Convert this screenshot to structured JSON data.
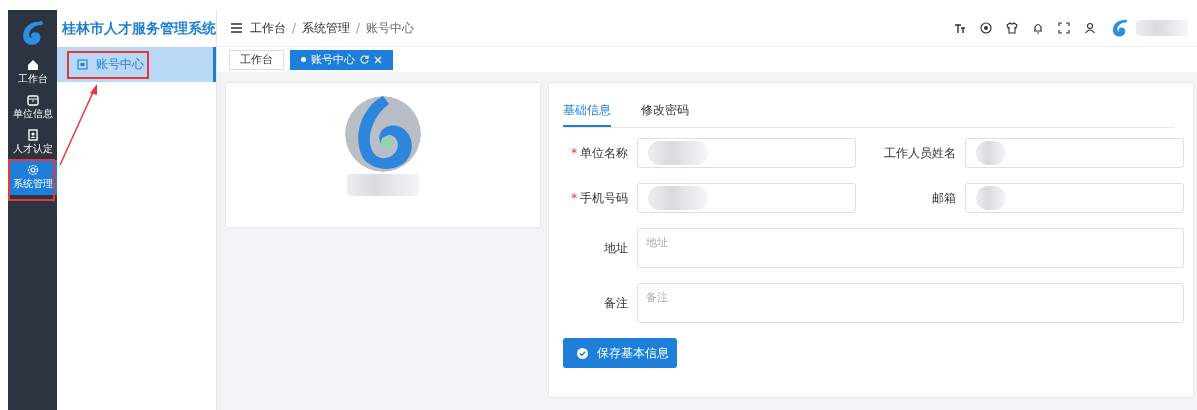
{
  "sidebar": {
    "items": [
      {
        "label": "工作台",
        "selected": false
      },
      {
        "label": "单位信息",
        "selected": false
      },
      {
        "label": "人才认定",
        "selected": false
      },
      {
        "label": "系统管理",
        "selected": true
      }
    ]
  },
  "app_title": "桂林市人才服务管理系统",
  "submenu": [
    {
      "label": "账号中心",
      "selected": true
    }
  ],
  "breadcrumb": [
    "工作台",
    "系统管理",
    "账号中心"
  ],
  "breadcrumb_separator": "/",
  "required_mark": "*",
  "tabs": [
    {
      "label": "工作台",
      "selected": false,
      "closable": false
    },
    {
      "label": "账号中心",
      "selected": true,
      "closable": true
    }
  ],
  "form_tabs": [
    {
      "label": "基础信息",
      "selected": true
    },
    {
      "label": "修改密码",
      "selected": false
    }
  ],
  "fields": [
    {
      "label": "单位名称",
      "required": true,
      "kind": "input",
      "redacted": true
    },
    {
      "label": "工作人员姓名",
      "required": false,
      "kind": "input",
      "redacted": true
    },
    {
      "label": "手机号码",
      "required": true,
      "kind": "input",
      "redacted": true
    },
    {
      "label": "邮箱",
      "required": false,
      "kind": "input",
      "redacted": true
    },
    {
      "label": "地址",
      "required": false,
      "kind": "textarea",
      "placeholder": "地址"
    },
    {
      "label": "备注",
      "required": false,
      "kind": "textarea",
      "placeholder": "备注"
    }
  ],
  "save_button": "保存基本信息"
}
